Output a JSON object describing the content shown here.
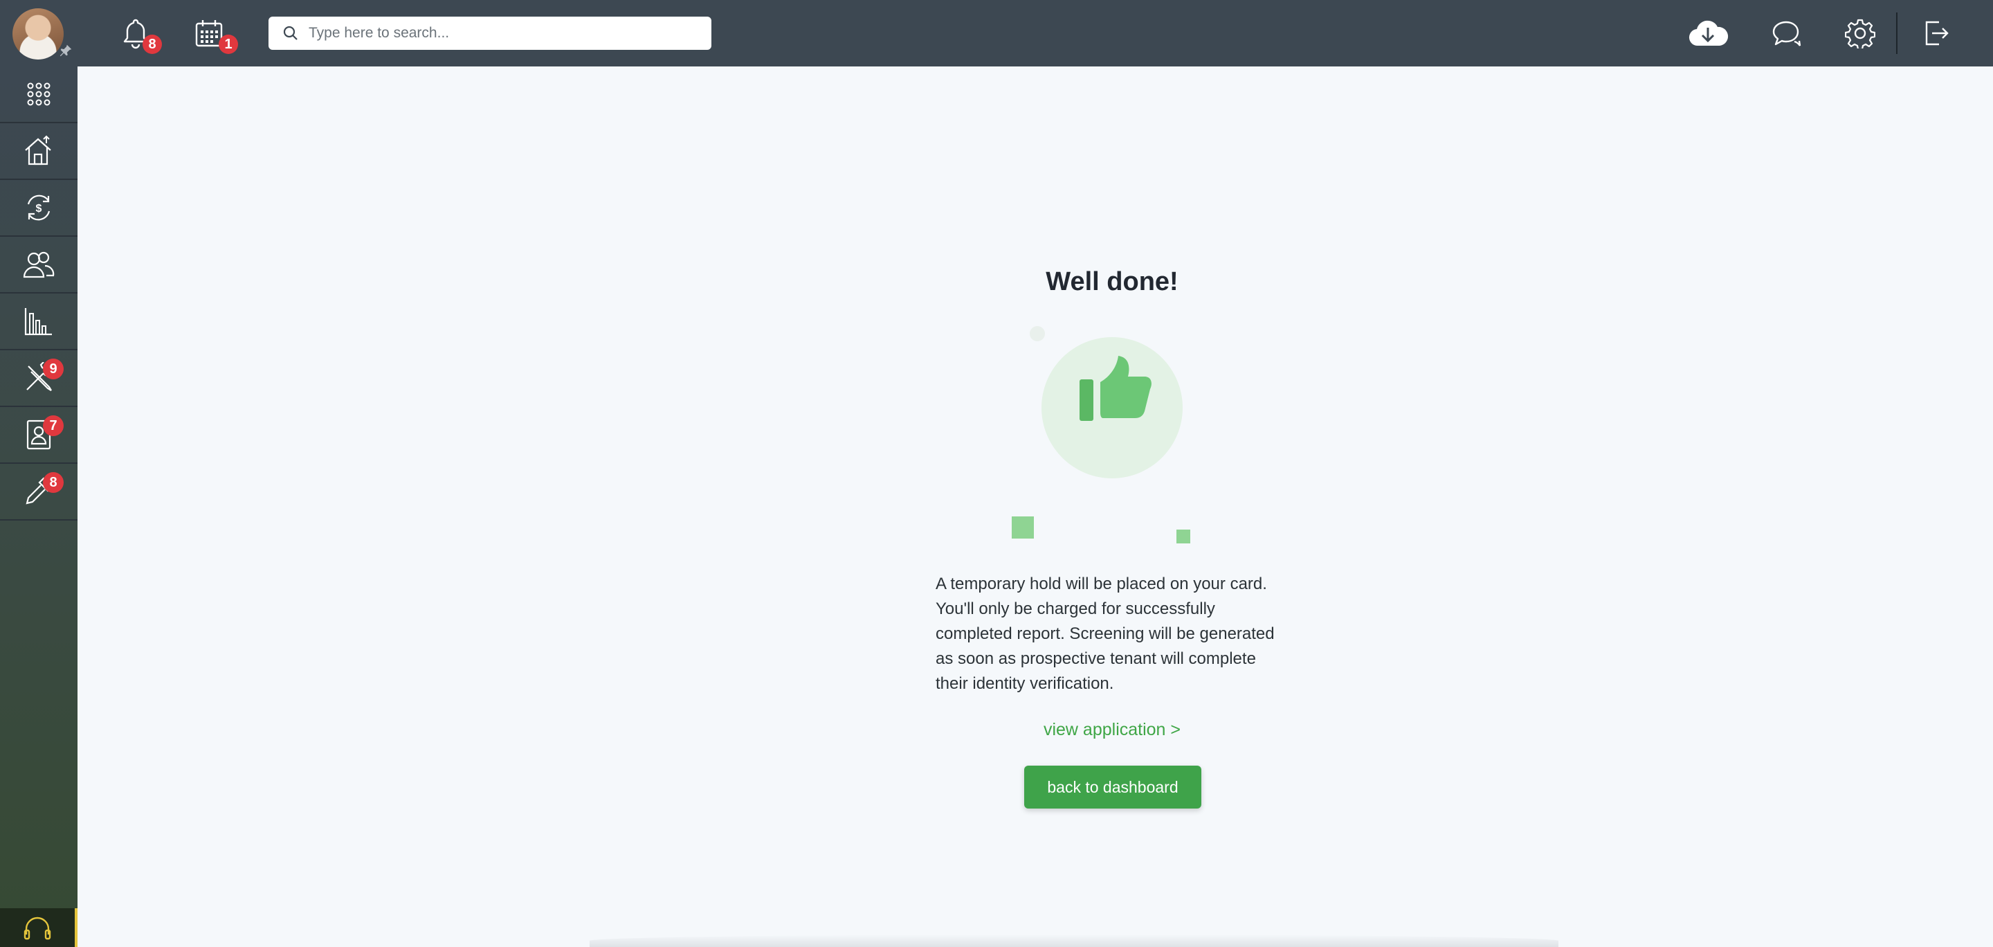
{
  "header": {
    "notifications_count": "8",
    "calendar_count": "1",
    "search_placeholder": "Type here to search..."
  },
  "sidebar": {
    "items": [
      {
        "name": "apps",
        "badge": ""
      },
      {
        "name": "properties",
        "badge": ""
      },
      {
        "name": "transactions",
        "badge": ""
      },
      {
        "name": "people",
        "badge": ""
      },
      {
        "name": "reports",
        "badge": ""
      },
      {
        "name": "maintenance",
        "badge": "9"
      },
      {
        "name": "applications",
        "badge": "7"
      },
      {
        "name": "tools",
        "badge": "8"
      }
    ]
  },
  "main": {
    "title": "Well done!",
    "message": "A temporary hold will be placed on your card. You'll only be charged for successfully completed report. Screening will be generated as soon as prospective tenant will complete their identity verification.",
    "view_link": "view application >",
    "back_button": "back to dashboard"
  },
  "colors": {
    "topbar": "#3d4852",
    "accent_green": "#3fa34a",
    "badge_red": "#e0383e",
    "page_bg": "#f5f8fb"
  }
}
